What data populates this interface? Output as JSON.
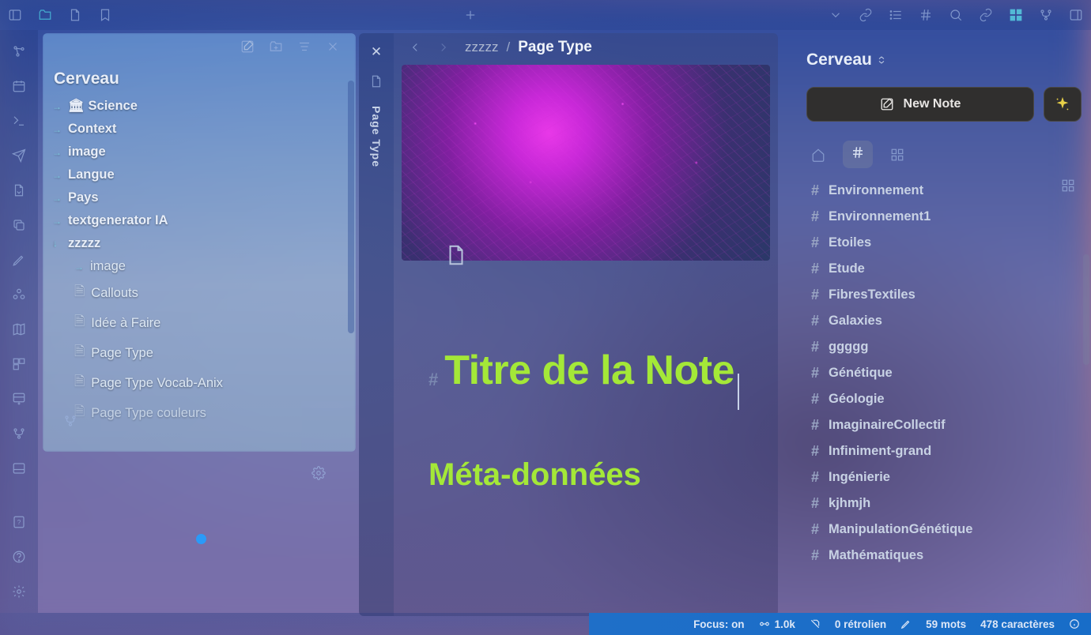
{
  "vault": {
    "title": "Cerveau"
  },
  "explorer": {
    "items": [
      {
        "label": "🏛 Science",
        "type": "folder"
      },
      {
        "label": "Context",
        "type": "folder"
      },
      {
        "label": "image",
        "type": "folder"
      },
      {
        "label": "Langue",
        "type": "folder"
      },
      {
        "label": "Pays",
        "type": "folder"
      },
      {
        "label": "textgenerator IA",
        "type": "folder"
      },
      {
        "label": "zzzzz",
        "type": "folder-open"
      }
    ],
    "children": [
      {
        "label": "image",
        "icon": "arrow"
      },
      {
        "label": "Callouts",
        "icon": "file"
      },
      {
        "label": "Idée à Faire",
        "icon": "file"
      },
      {
        "label": "Page Type",
        "icon": "file"
      },
      {
        "label": "Page Type Vocab-Anix",
        "icon": "file"
      },
      {
        "label": "Page Type couleurs",
        "icon": "file"
      }
    ]
  },
  "vtab": {
    "label": "Page Type"
  },
  "editor": {
    "breadcrumb": {
      "parent": "zzzzz",
      "current": "Page Type"
    },
    "h1": "Titre de la Note",
    "h2": "Méta-données"
  },
  "rightbar": {
    "title": "Cerveau",
    "new_note_label": "New Note",
    "tags": [
      "Environnement",
      "Environnement1",
      "Etoiles",
      "Etude",
      "FibresTextiles",
      "Galaxies",
      "ggggg",
      "Génétique",
      "Géologie",
      "ImaginaireCollectif",
      "Infiniment-grand",
      "Ingénierie",
      "kjhmjh",
      "ManipulationGénétique",
      "Mathématiques"
    ]
  },
  "status": {
    "focus": "Focus: on",
    "size": "1.0k",
    "backlinks": "0 rétrolien",
    "words": "59 mots",
    "chars": "478 caractères"
  }
}
